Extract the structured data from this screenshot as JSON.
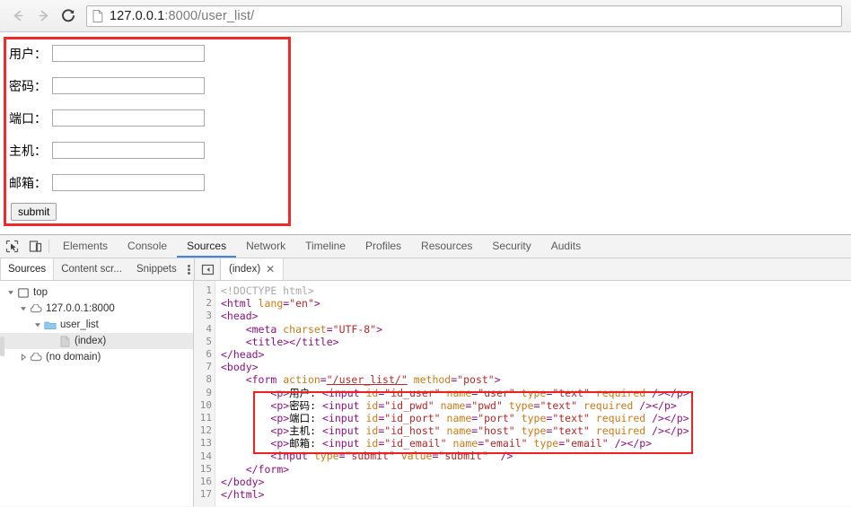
{
  "browser": {
    "back_icon": "arrow-left-icon",
    "forward_icon": "arrow-right-icon",
    "reload_icon": "reload-icon",
    "page_icon": "document-icon",
    "url_host": "127.0.0.1",
    "url_rest": ":8000/user_list/",
    "url_full": "127.0.0.1:8000/user_list/"
  },
  "page": {
    "form": {
      "fields": [
        {
          "label": "用户：",
          "value": "",
          "name": "user"
        },
        {
          "label": "密码：",
          "value": "",
          "name": "pwd"
        },
        {
          "label": "端口：",
          "value": "",
          "name": "port"
        },
        {
          "label": "主机：",
          "value": "",
          "name": "host"
        },
        {
          "label": "邮箱：",
          "value": "",
          "name": "email"
        }
      ],
      "submit_label": "submit"
    },
    "highlight_color": "#ef2b2b"
  },
  "devtools": {
    "inspect_icon": "inspect-element-icon",
    "device_icon": "device-toolbar-icon",
    "tabs": [
      {
        "label": "Elements",
        "active": false
      },
      {
        "label": "Console",
        "active": false
      },
      {
        "label": "Sources",
        "active": true
      },
      {
        "label": "Network",
        "active": false
      },
      {
        "label": "Timeline",
        "active": false
      },
      {
        "label": "Profiles",
        "active": false
      },
      {
        "label": "Resources",
        "active": false
      },
      {
        "label": "Security",
        "active": false
      },
      {
        "label": "Audits",
        "active": false
      }
    ],
    "active_tab_color": "#4285dd",
    "subtabs": [
      {
        "label": "Sources",
        "active": true
      },
      {
        "label": "Content scr...",
        "active": false
      },
      {
        "label": "Snippets",
        "active": false
      }
    ],
    "more_icon": "kebab-menu-icon",
    "panel_toggle_icon": "show-navigator-icon",
    "file_tab": {
      "label": "(index)",
      "close_icon": "close-icon"
    },
    "tree": [
      {
        "label": "top",
        "depth": 0,
        "icon": "frame-icon",
        "twisty": "open",
        "selected": false
      },
      {
        "label": "127.0.0.1:8000",
        "depth": 1,
        "icon": "cloud-icon",
        "twisty": "open",
        "selected": false
      },
      {
        "label": "user_list",
        "depth": 2,
        "icon": "folder-icon",
        "twisty": "open",
        "selected": false
      },
      {
        "label": "(index)",
        "depth": 3,
        "icon": "file-icon",
        "twisty": "none",
        "selected": true
      },
      {
        "label": "(no domain)",
        "depth": 1,
        "icon": "cloud-icon",
        "twisty": "closed",
        "selected": false
      }
    ],
    "editor": {
      "line_numbers": [
        "1",
        "2",
        "3",
        "4",
        "5",
        "6",
        "7",
        "8",
        "9",
        "10",
        "11",
        "12",
        "13",
        "14",
        "15",
        "16",
        "17"
      ],
      "highlight_color": "#ee2020",
      "lines": [
        [
          {
            "t": "com",
            "s": "<!DOCTYPE html>"
          }
        ],
        [
          {
            "t": "tag",
            "s": "<html "
          },
          {
            "t": "attr",
            "s": "lang"
          },
          {
            "t": "tag",
            "s": "="
          },
          {
            "t": "val",
            "s": "\"en\""
          },
          {
            "t": "tag",
            "s": ">"
          }
        ],
        [
          {
            "t": "tag",
            "s": "<head>"
          }
        ],
        [
          {
            "t": "txt",
            "s": "    "
          },
          {
            "t": "tag",
            "s": "<meta "
          },
          {
            "t": "attr",
            "s": "charset"
          },
          {
            "t": "tag",
            "s": "="
          },
          {
            "t": "val",
            "s": "\"UTF-8\""
          },
          {
            "t": "tag",
            "s": ">"
          }
        ],
        [
          {
            "t": "txt",
            "s": "    "
          },
          {
            "t": "tag",
            "s": "<title></title>"
          }
        ],
        [
          {
            "t": "tag",
            "s": "</head>"
          }
        ],
        [
          {
            "t": "tag",
            "s": "<body>"
          }
        ],
        [
          {
            "t": "txt",
            "s": "    "
          },
          {
            "t": "tag",
            "s": "<form "
          },
          {
            "t": "attr",
            "s": "action"
          },
          {
            "t": "tag",
            "s": "="
          },
          {
            "t": "val-link",
            "s": "\"/user_list/\""
          },
          {
            "t": "txt",
            "s": " "
          },
          {
            "t": "attr",
            "s": "method"
          },
          {
            "t": "tag",
            "s": "="
          },
          {
            "t": "val",
            "s": "\"post\""
          },
          {
            "t": "tag",
            "s": ">"
          }
        ],
        [
          {
            "t": "txt",
            "s": "        "
          },
          {
            "t": "tag",
            "s": "<p>"
          },
          {
            "t": "txt",
            "s": "用户: "
          },
          {
            "t": "tag",
            "s": "<input "
          },
          {
            "t": "attr",
            "s": "id"
          },
          {
            "t": "tag",
            "s": "="
          },
          {
            "t": "val",
            "s": "\"id_user\""
          },
          {
            "t": "txt",
            "s": " "
          },
          {
            "t": "attr",
            "s": "name"
          },
          {
            "t": "tag",
            "s": "="
          },
          {
            "t": "val",
            "s": "\"user\""
          },
          {
            "t": "txt",
            "s": " "
          },
          {
            "t": "attr",
            "s": "type"
          },
          {
            "t": "tag",
            "s": "="
          },
          {
            "t": "val",
            "s": "\"text\""
          },
          {
            "t": "txt",
            "s": " "
          },
          {
            "t": "attr",
            "s": "required"
          },
          {
            "t": "tag",
            "s": " /></p>"
          }
        ],
        [
          {
            "t": "txt",
            "s": "        "
          },
          {
            "t": "tag",
            "s": "<p>"
          },
          {
            "t": "txt",
            "s": "密码: "
          },
          {
            "t": "tag",
            "s": "<input "
          },
          {
            "t": "attr",
            "s": "id"
          },
          {
            "t": "tag",
            "s": "="
          },
          {
            "t": "val",
            "s": "\"id_pwd\""
          },
          {
            "t": "txt",
            "s": " "
          },
          {
            "t": "attr",
            "s": "name"
          },
          {
            "t": "tag",
            "s": "="
          },
          {
            "t": "val",
            "s": "\"pwd\""
          },
          {
            "t": "txt",
            "s": " "
          },
          {
            "t": "attr",
            "s": "type"
          },
          {
            "t": "tag",
            "s": "="
          },
          {
            "t": "val",
            "s": "\"text\""
          },
          {
            "t": "txt",
            "s": " "
          },
          {
            "t": "attr",
            "s": "required"
          },
          {
            "t": "tag",
            "s": " /></p>"
          }
        ],
        [
          {
            "t": "txt",
            "s": "        "
          },
          {
            "t": "tag",
            "s": "<p>"
          },
          {
            "t": "txt",
            "s": "端口: "
          },
          {
            "t": "tag",
            "s": "<input "
          },
          {
            "t": "attr",
            "s": "id"
          },
          {
            "t": "tag",
            "s": "="
          },
          {
            "t": "val",
            "s": "\"id_port\""
          },
          {
            "t": "txt",
            "s": " "
          },
          {
            "t": "attr",
            "s": "name"
          },
          {
            "t": "tag",
            "s": "="
          },
          {
            "t": "val",
            "s": "\"port\""
          },
          {
            "t": "txt",
            "s": " "
          },
          {
            "t": "attr",
            "s": "type"
          },
          {
            "t": "tag",
            "s": "="
          },
          {
            "t": "val",
            "s": "\"text\""
          },
          {
            "t": "txt",
            "s": " "
          },
          {
            "t": "attr",
            "s": "required"
          },
          {
            "t": "tag",
            "s": " /></p>"
          }
        ],
        [
          {
            "t": "txt",
            "s": "        "
          },
          {
            "t": "tag",
            "s": "<p>"
          },
          {
            "t": "txt",
            "s": "主机: "
          },
          {
            "t": "tag",
            "s": "<input "
          },
          {
            "t": "attr",
            "s": "id"
          },
          {
            "t": "tag",
            "s": "="
          },
          {
            "t": "val",
            "s": "\"id_host\""
          },
          {
            "t": "txt",
            "s": " "
          },
          {
            "t": "attr",
            "s": "name"
          },
          {
            "t": "tag",
            "s": "="
          },
          {
            "t": "val",
            "s": "\"host\""
          },
          {
            "t": "txt",
            "s": " "
          },
          {
            "t": "attr",
            "s": "type"
          },
          {
            "t": "tag",
            "s": "="
          },
          {
            "t": "val",
            "s": "\"text\""
          },
          {
            "t": "txt",
            "s": " "
          },
          {
            "t": "attr",
            "s": "required"
          },
          {
            "t": "tag",
            "s": " /></p>"
          }
        ],
        [
          {
            "t": "txt",
            "s": "        "
          },
          {
            "t": "tag",
            "s": "<p>"
          },
          {
            "t": "txt",
            "s": "邮箱: "
          },
          {
            "t": "tag",
            "s": "<input "
          },
          {
            "t": "attr",
            "s": "id"
          },
          {
            "t": "tag",
            "s": "="
          },
          {
            "t": "val",
            "s": "\"id_email\""
          },
          {
            "t": "txt",
            "s": " "
          },
          {
            "t": "attr",
            "s": "name"
          },
          {
            "t": "tag",
            "s": "="
          },
          {
            "t": "val",
            "s": "\"email\""
          },
          {
            "t": "txt",
            "s": " "
          },
          {
            "t": "attr",
            "s": "type"
          },
          {
            "t": "tag",
            "s": "="
          },
          {
            "t": "val",
            "s": "\"email\""
          },
          {
            "t": "tag",
            "s": " /></p>"
          }
        ],
        [
          {
            "t": "txt",
            "s": "        "
          },
          {
            "t": "tag",
            "s": "<input "
          },
          {
            "t": "attr",
            "s": "type"
          },
          {
            "t": "tag",
            "s": "="
          },
          {
            "t": "val",
            "s": "\"submit\""
          },
          {
            "t": "txt",
            "s": " "
          },
          {
            "t": "attr",
            "s": "value"
          },
          {
            "t": "tag",
            "s": "="
          },
          {
            "t": "val",
            "s": "\"submit\""
          },
          {
            "t": "tag",
            "s": "  />"
          }
        ],
        [
          {
            "t": "txt",
            "s": "    "
          },
          {
            "t": "tag",
            "s": "</form>"
          }
        ],
        [
          {
            "t": "tag",
            "s": "</body>"
          }
        ],
        [
          {
            "t": "tag",
            "s": "</html>"
          }
        ]
      ]
    }
  }
}
